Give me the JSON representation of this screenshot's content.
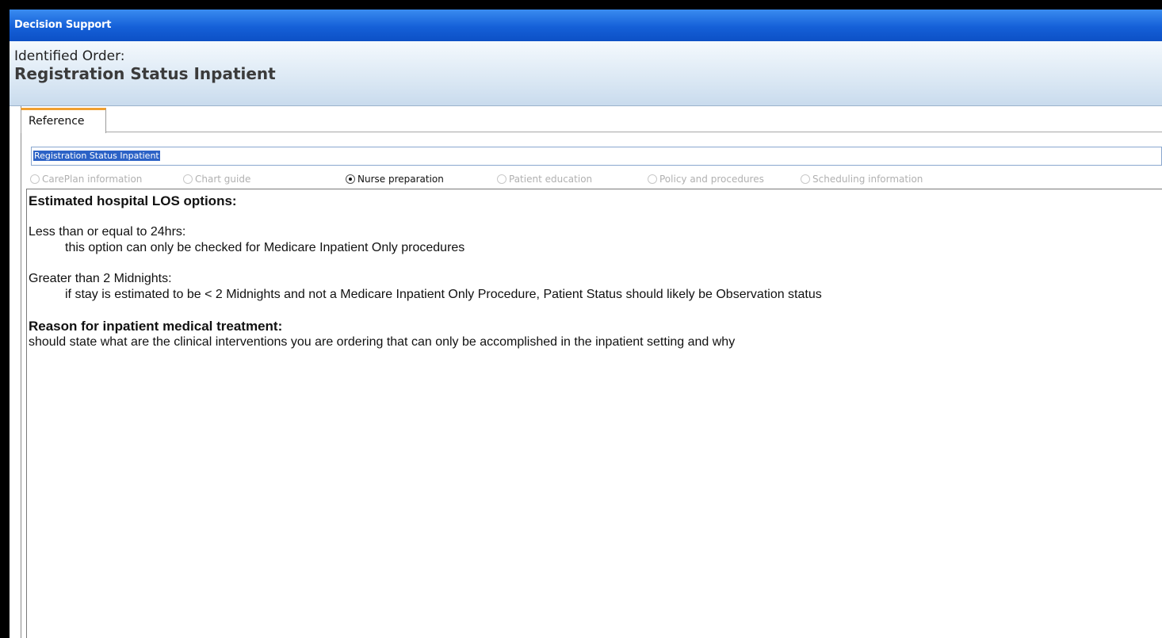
{
  "window": {
    "title": "Decision Support"
  },
  "header": {
    "label": "Identified Order:",
    "order_name": "Registration Status Inpatient"
  },
  "tabs": [
    {
      "label": "Reference",
      "active": true
    }
  ],
  "reference_field": {
    "value": "Registration Status Inpatient"
  },
  "radio_options": [
    {
      "label": "CarePlan information",
      "checked": false,
      "enabled": false
    },
    {
      "label": "Chart guide",
      "checked": false,
      "enabled": false
    },
    {
      "label": "Nurse preparation",
      "checked": true,
      "enabled": true
    },
    {
      "label": "Patient education",
      "checked": false,
      "enabled": false
    },
    {
      "label": "Policy and procedures",
      "checked": false,
      "enabled": false
    },
    {
      "label": "Scheduling information",
      "checked": false,
      "enabled": false
    }
  ],
  "content": {
    "heading1": "Estimated hospital LOS options:",
    "opt1_title": "Less than or equal to 24hrs:",
    "opt1_detail": "this option can only be checked for Medicare Inpatient Only procedures",
    "opt2_title": "Greater than 2 Midnights:",
    "opt2_detail": "if stay is estimated to be < 2 Midnights and not a Medicare Inpatient Only Procedure, Patient Status should likely be Observation status",
    "heading2": "Reason for inpatient medical treatment:",
    "reason_text": "should state what are the clinical interventions you are ordering that can only be accomplished in the inpatient setting and why"
  },
  "colors": {
    "titlebar": "#1560d8",
    "header_bg": "#dbe8f4",
    "tab_accent": "#f0a030",
    "selection": "#2c62c6"
  }
}
